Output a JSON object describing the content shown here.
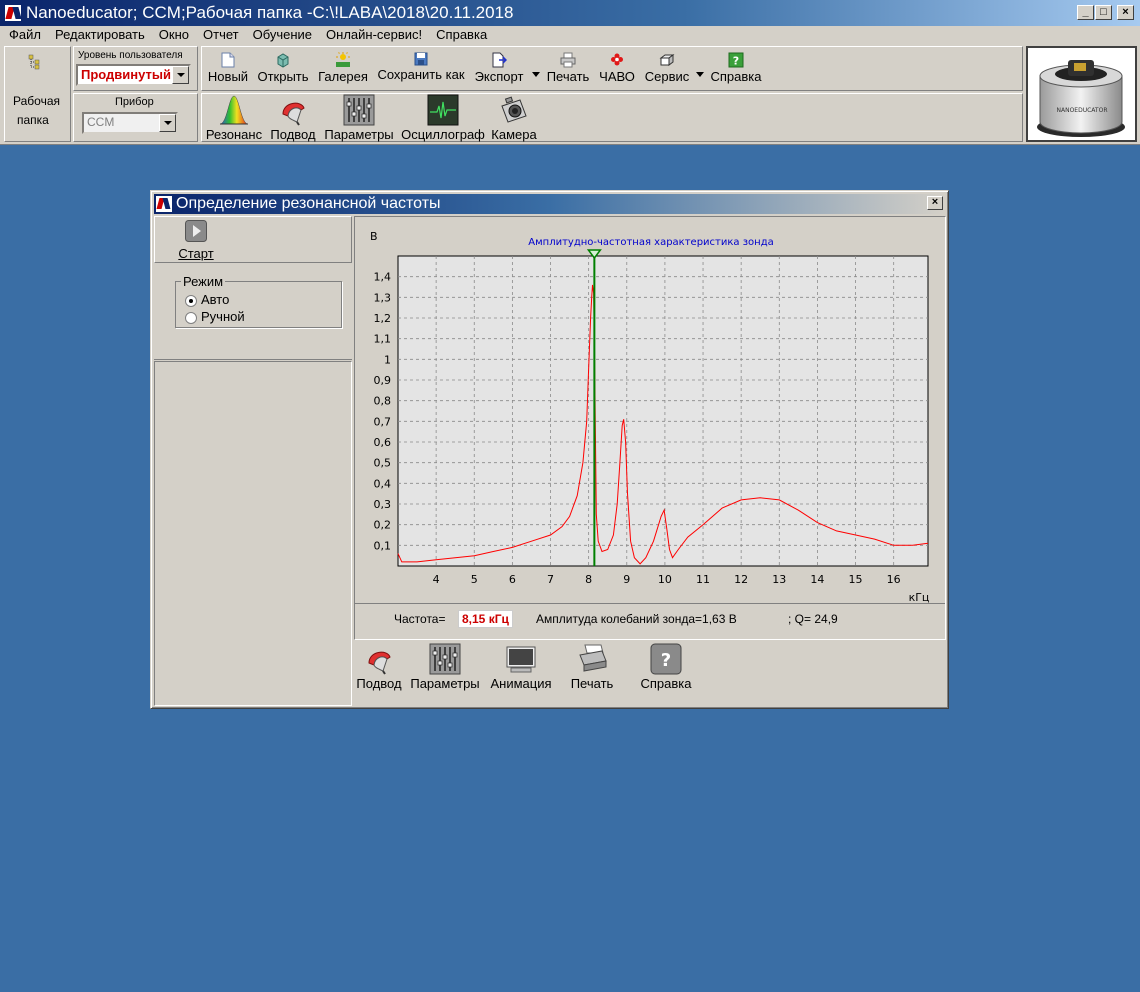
{
  "window": {
    "title": "Nanoeducator; CCM;Рабочая папка -C:\\!LABA\\2018\\20.11.2018",
    "min_label": "_",
    "max_label": "□",
    "close_label": "×"
  },
  "menu": [
    "Файл",
    "Редактировать",
    "Окно",
    "Отчет",
    "Обучение",
    "Онлайн-сервис!",
    "Справка"
  ],
  "workspace": {
    "folder_label_1": "Рабочая",
    "folder_label_2": "папка",
    "user_level_label": "Уровень пользователя",
    "user_level_value": "Продвинутый",
    "device_label": "Прибор",
    "device_value": "CCM"
  },
  "toolbar_top": {
    "new": "Новый",
    "open": "Открыть",
    "gallery": "Галерея",
    "save_as": "Сохранить как",
    "export": "Экспорт",
    "print": "Печать",
    "faq": "ЧАВО",
    "service": "Сервис",
    "help": "Справка"
  },
  "toolbar_bottom": {
    "resonance": "Резонанс",
    "approach": "Подвод",
    "parameters": "Параметры",
    "oscilloscope": "Осциллограф",
    "camera": "Камера"
  },
  "device_image_text": "NANOEDUCATOR",
  "dialog": {
    "title": "Определение резонансной частоты",
    "close_label": "×",
    "start_label": "Старт",
    "mode_label": "Режим",
    "mode_auto": "Авто",
    "mode_manual": "Ручной",
    "mode_selected": "auto",
    "freq_label": "Частота=",
    "freq_value": "8,15 кГц",
    "amplitude_text": "Амплитуда колебаний зонда=1,63 В",
    "q_text": "; Q= 24,9",
    "bottom_buttons": {
      "approach": "Подвод",
      "parameters": "Параметры",
      "animation": "Анимация",
      "print": "Печать",
      "help": "Справка"
    }
  },
  "colors": {
    "desktop": "#3a6ea5",
    "curve": "#ff0000",
    "marker": "#008000",
    "chart_title": "#0000cc",
    "freq_value": "#cc0000"
  },
  "chart_data": {
    "type": "line",
    "title": "Амплитудно-частотная характеристика зонда",
    "ylabel": "В",
    "xlabel": "кГц",
    "xlim": [
      3.0,
      16.9
    ],
    "ylim": [
      0,
      1.5
    ],
    "xticks": [
      4,
      5,
      6,
      7,
      8,
      9,
      10,
      11,
      12,
      13,
      14,
      15,
      16
    ],
    "yticks": [
      0.1,
      0.2,
      0.3,
      0.4,
      0.5,
      0.6,
      0.7,
      0.8,
      0.9,
      1.0,
      1.1,
      1.2,
      1.3,
      1.4
    ],
    "ytick_labels": [
      "0,1",
      "0,2",
      "0,3",
      "0,4",
      "0,5",
      "0,6",
      "0,7",
      "0,8",
      "0,9",
      "1",
      "1,1",
      "1,2",
      "1,3",
      "1,4"
    ],
    "grid": true,
    "marker_x": 8.15,
    "series": [
      {
        "x": [
          3.0,
          3.1,
          3.2,
          3.5,
          4.0,
          4.5,
          5.0,
          5.5,
          6.0,
          6.5,
          7.0,
          7.3,
          7.5,
          7.7,
          7.85,
          7.95,
          8.0,
          8.05,
          8.08,
          8.1,
          8.13,
          8.15,
          8.18,
          8.2,
          8.25,
          8.35,
          8.5,
          8.65,
          8.75,
          8.82,
          8.88,
          8.92,
          8.97,
          9.02,
          9.1,
          9.2,
          9.35,
          9.5,
          9.7,
          9.8,
          9.9,
          9.98,
          10.05,
          10.12,
          10.2,
          10.35,
          10.6,
          11.0,
          11.5,
          12.0,
          12.5,
          13.0,
          13.5,
          14.0,
          14.5,
          15.0,
          15.5,
          16.0,
          16.5,
          16.9
        ],
        "y": [
          0.06,
          0.02,
          0.02,
          0.02,
          0.03,
          0.04,
          0.05,
          0.07,
          0.09,
          0.12,
          0.15,
          0.19,
          0.24,
          0.34,
          0.5,
          0.7,
          0.95,
          1.2,
          1.3,
          1.36,
          1.32,
          1.1,
          0.6,
          0.25,
          0.12,
          0.07,
          0.08,
          0.15,
          0.3,
          0.5,
          0.68,
          0.71,
          0.6,
          0.35,
          0.12,
          0.04,
          0.01,
          0.04,
          0.12,
          0.18,
          0.24,
          0.27,
          0.18,
          0.08,
          0.04,
          0.08,
          0.14,
          0.2,
          0.28,
          0.32,
          0.33,
          0.32,
          0.27,
          0.21,
          0.17,
          0.15,
          0.13,
          0.1,
          0.1,
          0.11
        ]
      }
    ]
  }
}
